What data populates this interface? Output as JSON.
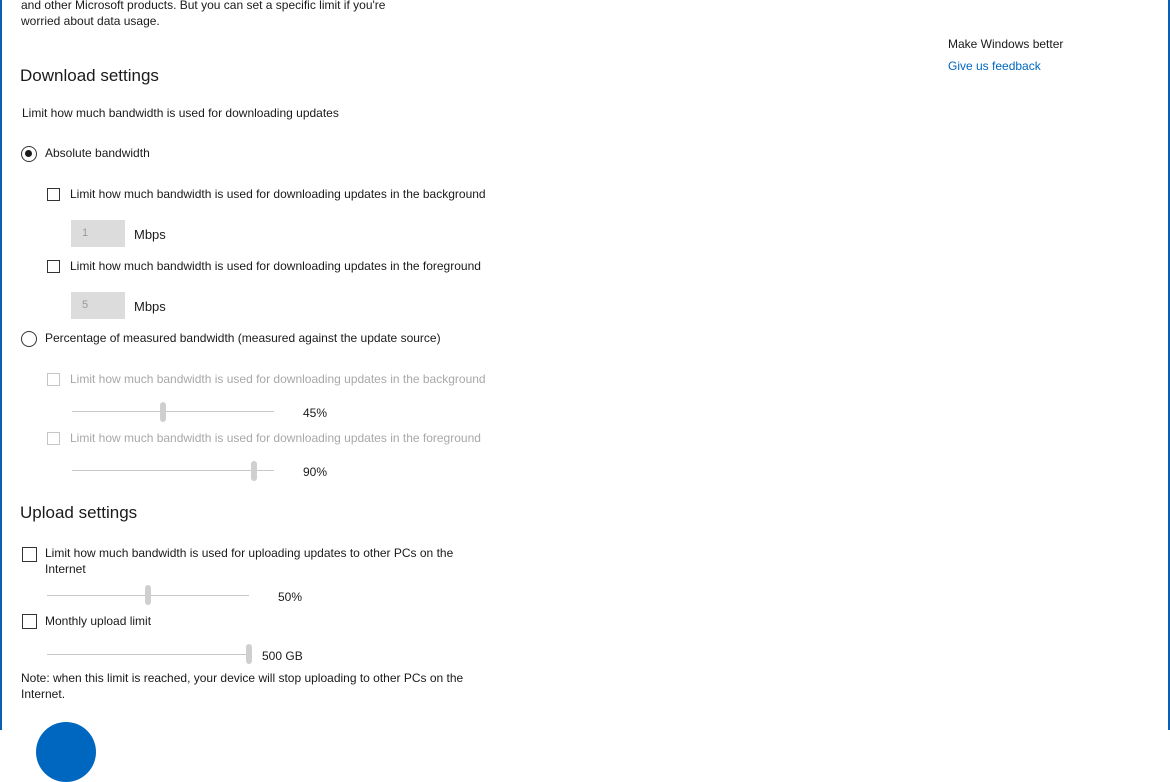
{
  "intro": {
    "line1": "and other Microsoft products. But you can set a specific limit if you're",
    "line2": "worried about data usage."
  },
  "side": {
    "heading": "Make Windows better",
    "feedback_link": "Give us feedback"
  },
  "download": {
    "title": "Download settings",
    "subtitle": "Limit how much bandwidth is used for downloading updates",
    "absolute": {
      "label": "Absolute bandwidth",
      "background_label": "Limit how much bandwidth is used for downloading updates in the background",
      "background_value": "1",
      "background_unit": "Mbps",
      "foreground_label": "Limit how much bandwidth is used for downloading updates in the foreground",
      "foreground_value": "5",
      "foreground_unit": "Mbps"
    },
    "percentage": {
      "label": "Percentage of measured bandwidth (measured against the update source)",
      "background_label": "Limit how much bandwidth is used for downloading updates in the background",
      "background_value": "45%",
      "background_level": 0.45,
      "foreground_label": "Limit how much bandwidth is used for downloading updates in the foreground",
      "foreground_value": "90%",
      "foreground_level": 0.9
    }
  },
  "upload": {
    "title": "Upload settings",
    "limit_label_line1": "Limit how much bandwidth is used for uploading updates to other PCs on the",
    "limit_label_line2": "Internet",
    "limit_value": "50%",
    "limit_level": 0.5,
    "monthly_label": "Monthly upload limit",
    "monthly_value": "500 GB",
    "monthly_level": 1.0,
    "note_line1": "Note: when this limit is reached, your device will stop uploading to other PCs on the",
    "note_line2": "Internet."
  }
}
